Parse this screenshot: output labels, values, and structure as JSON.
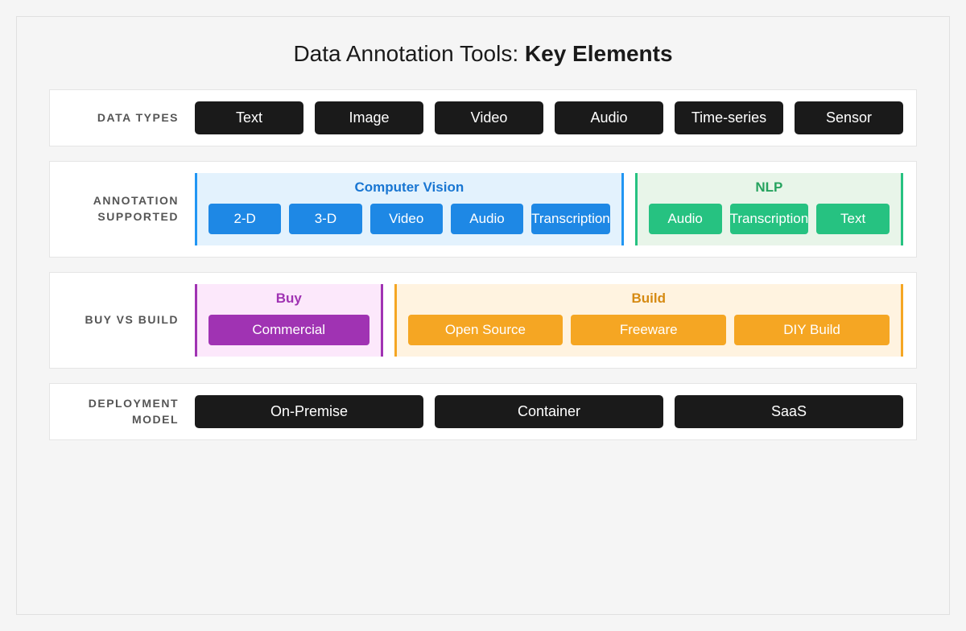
{
  "title_prefix": "Data Annotation Tools: ",
  "title_bold": "Key Elements",
  "sections": {
    "dataTypes": {
      "label": "DATA TYPES",
      "items": [
        "Text",
        "Image",
        "Video",
        "Audio",
        "Time-series",
        "Sensor"
      ]
    },
    "annotationSupported": {
      "label": "ANNOTATION SUPPORTED",
      "groups": {
        "cv": {
          "title": "Computer Vision",
          "items": [
            "2-D",
            "3-D",
            "Video",
            "Audio",
            "Transcription"
          ]
        },
        "nlp": {
          "title": "NLP",
          "items": [
            "Audio",
            "Transcription",
            "Text"
          ]
        }
      }
    },
    "buyVsBuild": {
      "label": "BUY VS BUILD",
      "groups": {
        "buy": {
          "title": "Buy",
          "items": [
            "Commercial"
          ]
        },
        "build": {
          "title": "Build",
          "items": [
            "Open Source",
            "Freeware",
            "DIY Build"
          ]
        }
      }
    },
    "deploymentModel": {
      "label": "DEPLOYMENT MODEL",
      "items": [
        "On-Premise",
        "Container",
        "SaaS"
      ]
    }
  }
}
